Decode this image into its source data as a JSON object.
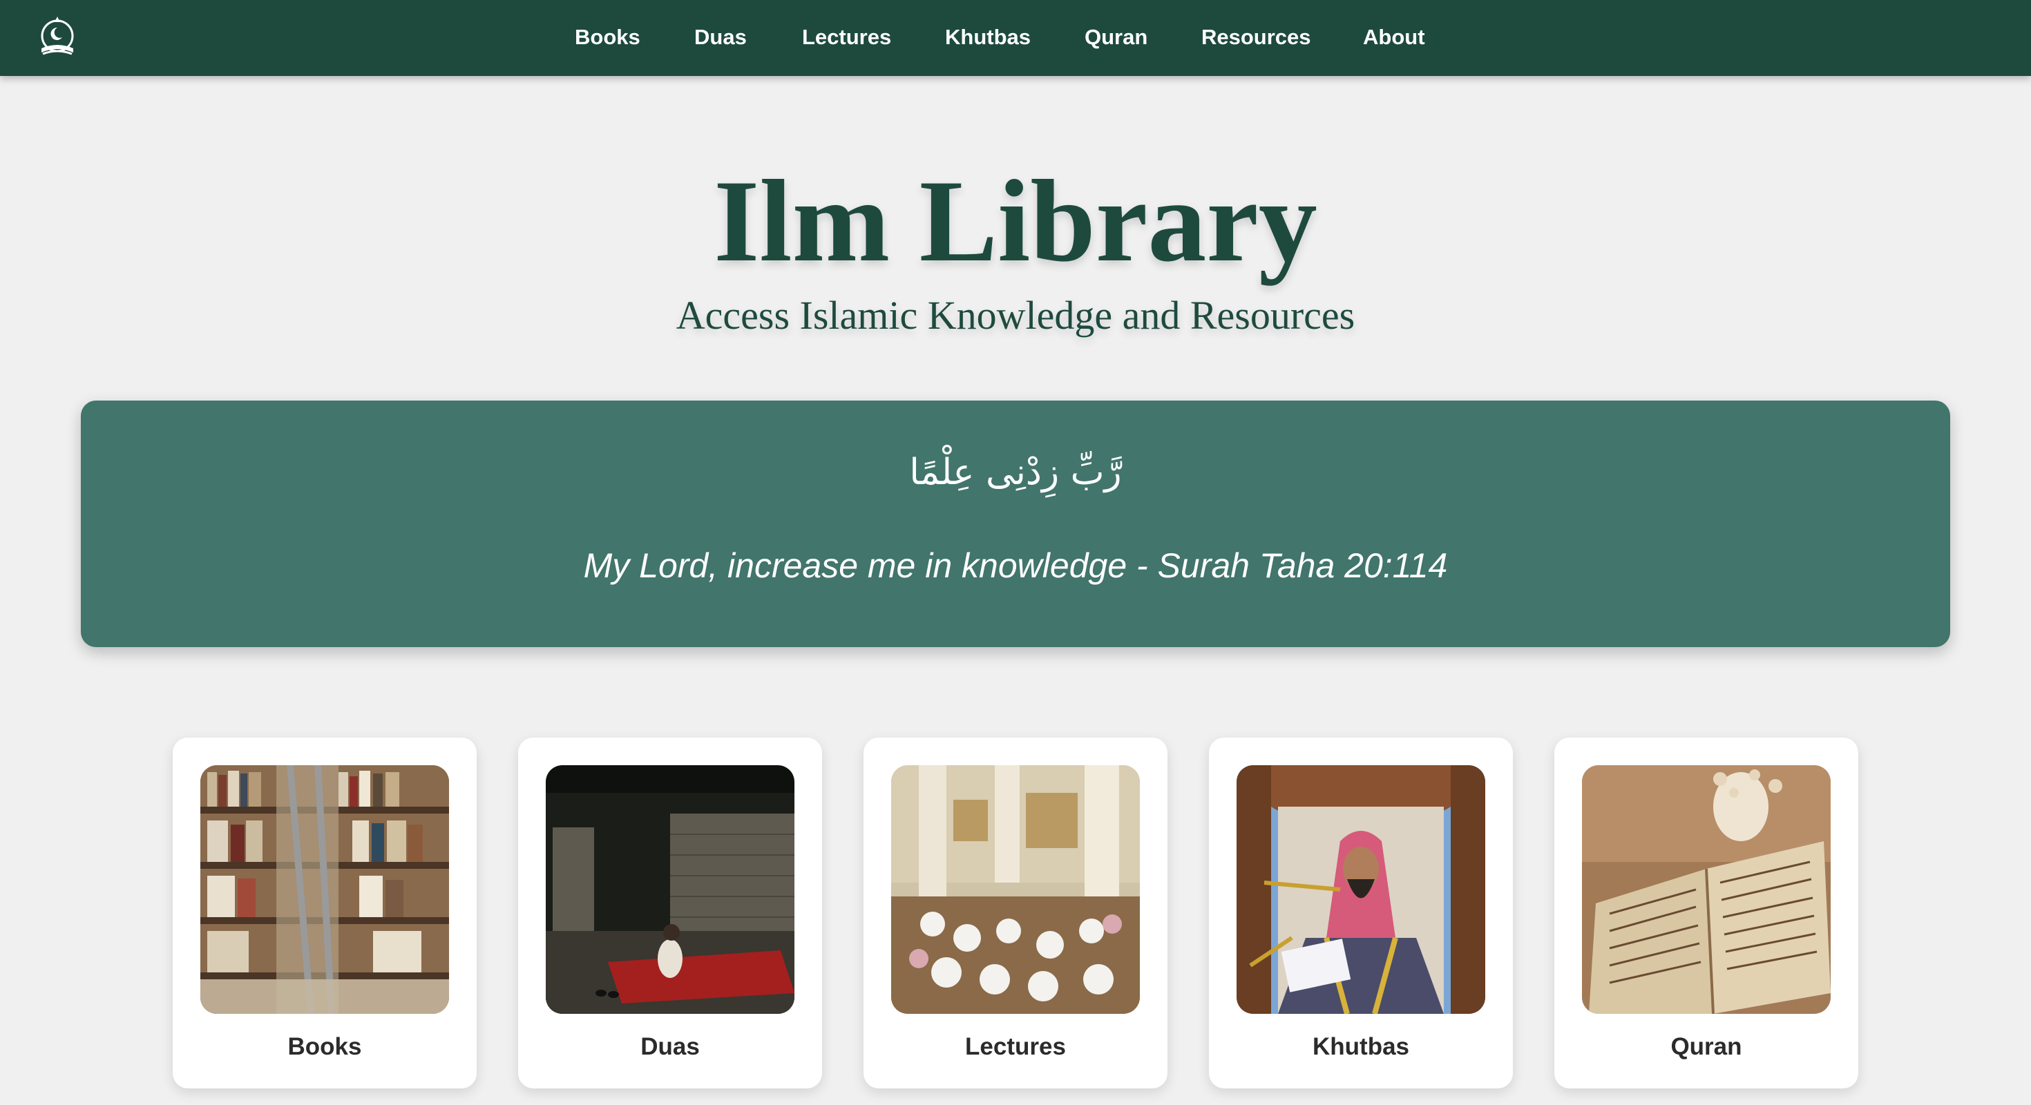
{
  "nav": {
    "logo_icon": "mosque-book-icon",
    "items": [
      {
        "label": "Books"
      },
      {
        "label": "Duas"
      },
      {
        "label": "Lectures"
      },
      {
        "label": "Khutbas"
      },
      {
        "label": "Quran"
      },
      {
        "label": "Resources"
      },
      {
        "label": "About"
      }
    ]
  },
  "hero": {
    "title": "Ilm Library",
    "subtitle": "Access Islamic Knowledge and Resources"
  },
  "quote": {
    "arabic": "رَّبِّ زِدْنِى عِلْمًا",
    "english": "My Lord, increase me in knowledge - Surah Taha 20:114"
  },
  "cards": [
    {
      "label": "Books",
      "image": "bookshelf-library-photo"
    },
    {
      "label": "Duas",
      "image": "person-praying-on-rug-photo"
    },
    {
      "label": "Lectures",
      "image": "mosque-study-circle-photo"
    },
    {
      "label": "Khutbas",
      "image": "imam-at-minbar-photo"
    },
    {
      "label": "Quran",
      "image": "open-quran-photo"
    }
  ],
  "colors": {
    "brand_dark": "#1e4a3e",
    "banner": "#42756c",
    "background": "#f0f0f0"
  }
}
